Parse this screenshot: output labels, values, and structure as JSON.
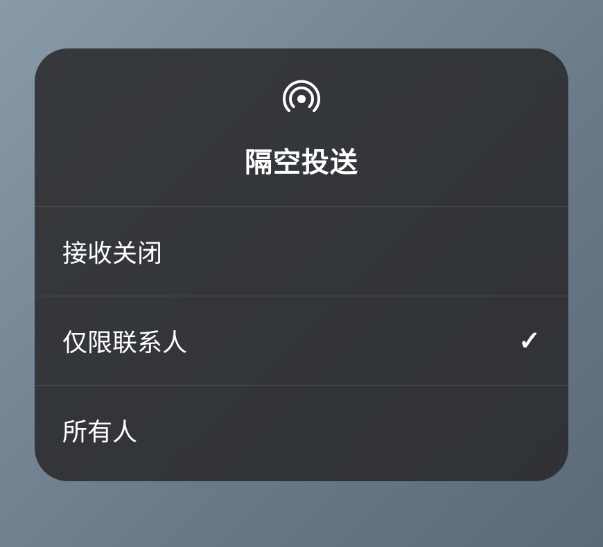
{
  "panel": {
    "title": "隔空投送",
    "icon": "airdrop-icon",
    "options": [
      {
        "label": "接收关闭",
        "selected": false
      },
      {
        "label": "仅限联系人",
        "selected": true
      },
      {
        "label": "所有人",
        "selected": false
      }
    ]
  }
}
